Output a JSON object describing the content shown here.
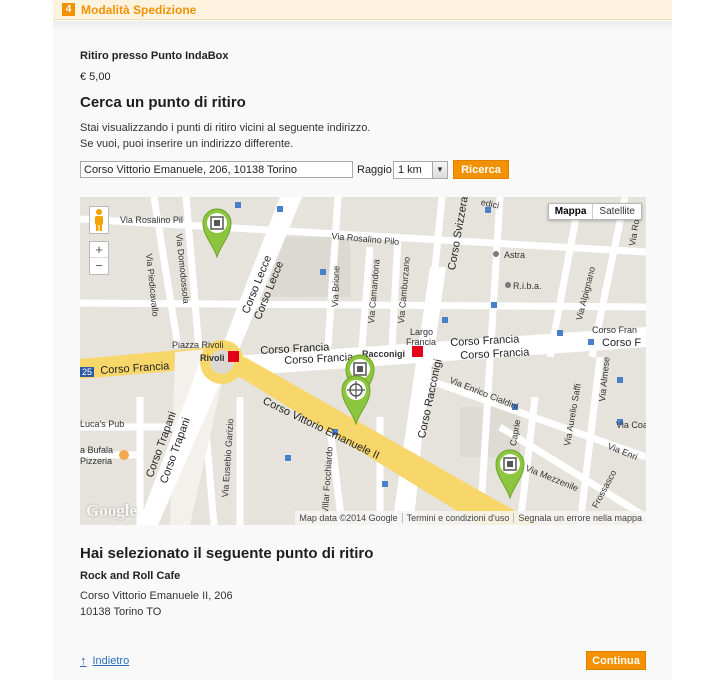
{
  "step": {
    "number": "4",
    "title": "Modalità Spedizione"
  },
  "shipping": {
    "name": "Ritiro presso Punto IndaBox",
    "price": "€ 5,00"
  },
  "search": {
    "title": "Cerca un punto di ritiro",
    "desc_line1": "Stai visualizzando i punti di ritiro vicini al seguente indirizzo.",
    "desc_line2": "Se vuoi, puoi inserire un indirizzo differente.",
    "address_value": "Corso Vittorio Emanuele, 206, 10138 Torino",
    "radius_label": "Raggio",
    "radius_value": "1 km",
    "search_button": "Ricerca"
  },
  "map": {
    "type_map": "Mappa",
    "type_satellite": "Satellite",
    "zoom_in": "+",
    "zoom_out": "−",
    "logo": "Google",
    "footer_data": "Map data ©2014 Google",
    "footer_terms": "Termini e condizioni d'uso",
    "footer_report": "Segnala un errore nella mappa",
    "streets": {
      "rosalino_pil": "Via Rosalino Pil",
      "rosalino_pilo": "Via Rosalino Pilo",
      "domodossola": "Via Domodossola",
      "piedicavallo": "Via Piedicavallo",
      "lecce1": "Corso Lecce",
      "lecce2": "Corso Lecce",
      "brione": "Via Brione",
      "camandona": "Via Camandona",
      "camburzano": "Via Camburzano",
      "svizzera": "Corso Svizzera",
      "astra": "Astra",
      "riba": "R.i.b.a.",
      "alpignano": "Via Alpignano",
      "piazza_rivoli": "Piazza Rivoli",
      "rivoli": "Rivoli",
      "corso_francia_left": "Corso Francia",
      "corso_francia_mid1": "Corso Francia",
      "corso_francia_mid2": "Corso Francia",
      "largo": "Largo",
      "francia": "Francia",
      "racconigi_metro": "Racconigi",
      "corso_francia_r1": "Corso Francia",
      "corso_francia_r2": "Corso Francia",
      "corso_fran_edge": "Corso Fran",
      "corso_f_edge": "Corso F",
      "num25": "25",
      "vittorio": "Corso Vittorio Emanuele II",
      "racconigi_corso": "Corso Racconigi",
      "cialdini": "Via Enrico Cialdini",
      "saffi": "Via Aurelio Saffi",
      "almese": "Via Almese",
      "via_coa": "Via Coa",
      "via_enri": "Via Enri",
      "lucas": "Luca's Pub",
      "bufala": "a Bufala",
      "pizzeria": "Pizzeria",
      "trapani1": "Corso Trapani",
      "trapani2": "Corso Trapani",
      "garizio": "Via Eusebio Garizio",
      "focchiardo": "Villar Focchiardo",
      "caprie": "Caprie",
      "mezzenile": "Via Mezzenile",
      "frossasco": "Frossasco",
      "rosa_edge": "Via Ros",
      "edicil": "edici"
    }
  },
  "selected": {
    "title": "Hai selezionato il seguente punto di ritiro",
    "name": "Rock and Roll Cafe",
    "address_line1": "Corso Vittorio Emanuele II, 206",
    "address_line2": "10138 Torino TO"
  },
  "nav": {
    "back": "Indietro",
    "continue": "Continua"
  },
  "colors": {
    "accent": "#f39200",
    "pin": "#8cc63f",
    "link": "#2a6ebb"
  }
}
